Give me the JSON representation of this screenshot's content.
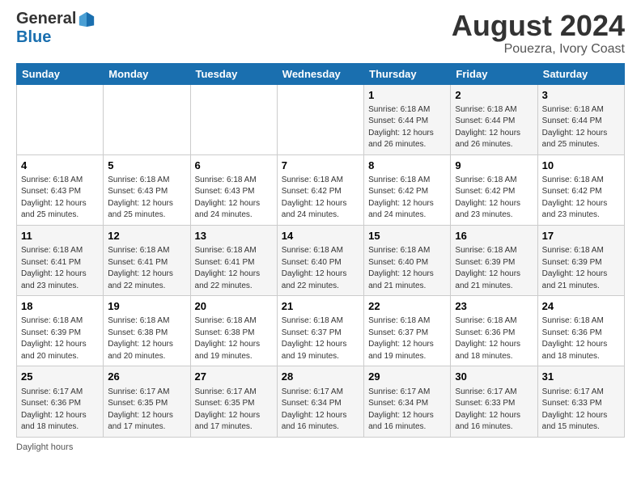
{
  "header": {
    "logo": {
      "general": "General",
      "blue": "Blue"
    },
    "title": "August 2024",
    "subtitle": "Pouezra, Ivory Coast"
  },
  "calendar": {
    "days_of_week": [
      "Sunday",
      "Monday",
      "Tuesday",
      "Wednesday",
      "Thursday",
      "Friday",
      "Saturday"
    ],
    "weeks": [
      [
        {
          "day": "",
          "info": ""
        },
        {
          "day": "",
          "info": ""
        },
        {
          "day": "",
          "info": ""
        },
        {
          "day": "",
          "info": ""
        },
        {
          "day": "1",
          "info": "Sunrise: 6:18 AM\nSunset: 6:44 PM\nDaylight: 12 hours\nand 26 minutes."
        },
        {
          "day": "2",
          "info": "Sunrise: 6:18 AM\nSunset: 6:44 PM\nDaylight: 12 hours\nand 26 minutes."
        },
        {
          "day": "3",
          "info": "Sunrise: 6:18 AM\nSunset: 6:44 PM\nDaylight: 12 hours\nand 25 minutes."
        }
      ],
      [
        {
          "day": "4",
          "info": "Sunrise: 6:18 AM\nSunset: 6:43 PM\nDaylight: 12 hours\nand 25 minutes."
        },
        {
          "day": "5",
          "info": "Sunrise: 6:18 AM\nSunset: 6:43 PM\nDaylight: 12 hours\nand 25 minutes."
        },
        {
          "day": "6",
          "info": "Sunrise: 6:18 AM\nSunset: 6:43 PM\nDaylight: 12 hours\nand 24 minutes."
        },
        {
          "day": "7",
          "info": "Sunrise: 6:18 AM\nSunset: 6:42 PM\nDaylight: 12 hours\nand 24 minutes."
        },
        {
          "day": "8",
          "info": "Sunrise: 6:18 AM\nSunset: 6:42 PM\nDaylight: 12 hours\nand 24 minutes."
        },
        {
          "day": "9",
          "info": "Sunrise: 6:18 AM\nSunset: 6:42 PM\nDaylight: 12 hours\nand 23 minutes."
        },
        {
          "day": "10",
          "info": "Sunrise: 6:18 AM\nSunset: 6:42 PM\nDaylight: 12 hours\nand 23 minutes."
        }
      ],
      [
        {
          "day": "11",
          "info": "Sunrise: 6:18 AM\nSunset: 6:41 PM\nDaylight: 12 hours\nand 23 minutes."
        },
        {
          "day": "12",
          "info": "Sunrise: 6:18 AM\nSunset: 6:41 PM\nDaylight: 12 hours\nand 22 minutes."
        },
        {
          "day": "13",
          "info": "Sunrise: 6:18 AM\nSunset: 6:41 PM\nDaylight: 12 hours\nand 22 minutes."
        },
        {
          "day": "14",
          "info": "Sunrise: 6:18 AM\nSunset: 6:40 PM\nDaylight: 12 hours\nand 22 minutes."
        },
        {
          "day": "15",
          "info": "Sunrise: 6:18 AM\nSunset: 6:40 PM\nDaylight: 12 hours\nand 21 minutes."
        },
        {
          "day": "16",
          "info": "Sunrise: 6:18 AM\nSunset: 6:39 PM\nDaylight: 12 hours\nand 21 minutes."
        },
        {
          "day": "17",
          "info": "Sunrise: 6:18 AM\nSunset: 6:39 PM\nDaylight: 12 hours\nand 21 minutes."
        }
      ],
      [
        {
          "day": "18",
          "info": "Sunrise: 6:18 AM\nSunset: 6:39 PM\nDaylight: 12 hours\nand 20 minutes."
        },
        {
          "day": "19",
          "info": "Sunrise: 6:18 AM\nSunset: 6:38 PM\nDaylight: 12 hours\nand 20 minutes."
        },
        {
          "day": "20",
          "info": "Sunrise: 6:18 AM\nSunset: 6:38 PM\nDaylight: 12 hours\nand 19 minutes."
        },
        {
          "day": "21",
          "info": "Sunrise: 6:18 AM\nSunset: 6:37 PM\nDaylight: 12 hours\nand 19 minutes."
        },
        {
          "day": "22",
          "info": "Sunrise: 6:18 AM\nSunset: 6:37 PM\nDaylight: 12 hours\nand 19 minutes."
        },
        {
          "day": "23",
          "info": "Sunrise: 6:18 AM\nSunset: 6:36 PM\nDaylight: 12 hours\nand 18 minutes."
        },
        {
          "day": "24",
          "info": "Sunrise: 6:18 AM\nSunset: 6:36 PM\nDaylight: 12 hours\nand 18 minutes."
        }
      ],
      [
        {
          "day": "25",
          "info": "Sunrise: 6:17 AM\nSunset: 6:36 PM\nDaylight: 12 hours\nand 18 minutes."
        },
        {
          "day": "26",
          "info": "Sunrise: 6:17 AM\nSunset: 6:35 PM\nDaylight: 12 hours\nand 17 minutes."
        },
        {
          "day": "27",
          "info": "Sunrise: 6:17 AM\nSunset: 6:35 PM\nDaylight: 12 hours\nand 17 minutes."
        },
        {
          "day": "28",
          "info": "Sunrise: 6:17 AM\nSunset: 6:34 PM\nDaylight: 12 hours\nand 16 minutes."
        },
        {
          "day": "29",
          "info": "Sunrise: 6:17 AM\nSunset: 6:34 PM\nDaylight: 12 hours\nand 16 minutes."
        },
        {
          "day": "30",
          "info": "Sunrise: 6:17 AM\nSunset: 6:33 PM\nDaylight: 12 hours\nand 16 minutes."
        },
        {
          "day": "31",
          "info": "Sunrise: 6:17 AM\nSunset: 6:33 PM\nDaylight: 12 hours\nand 15 minutes."
        }
      ]
    ]
  },
  "footer": {
    "text": "Daylight hours"
  }
}
